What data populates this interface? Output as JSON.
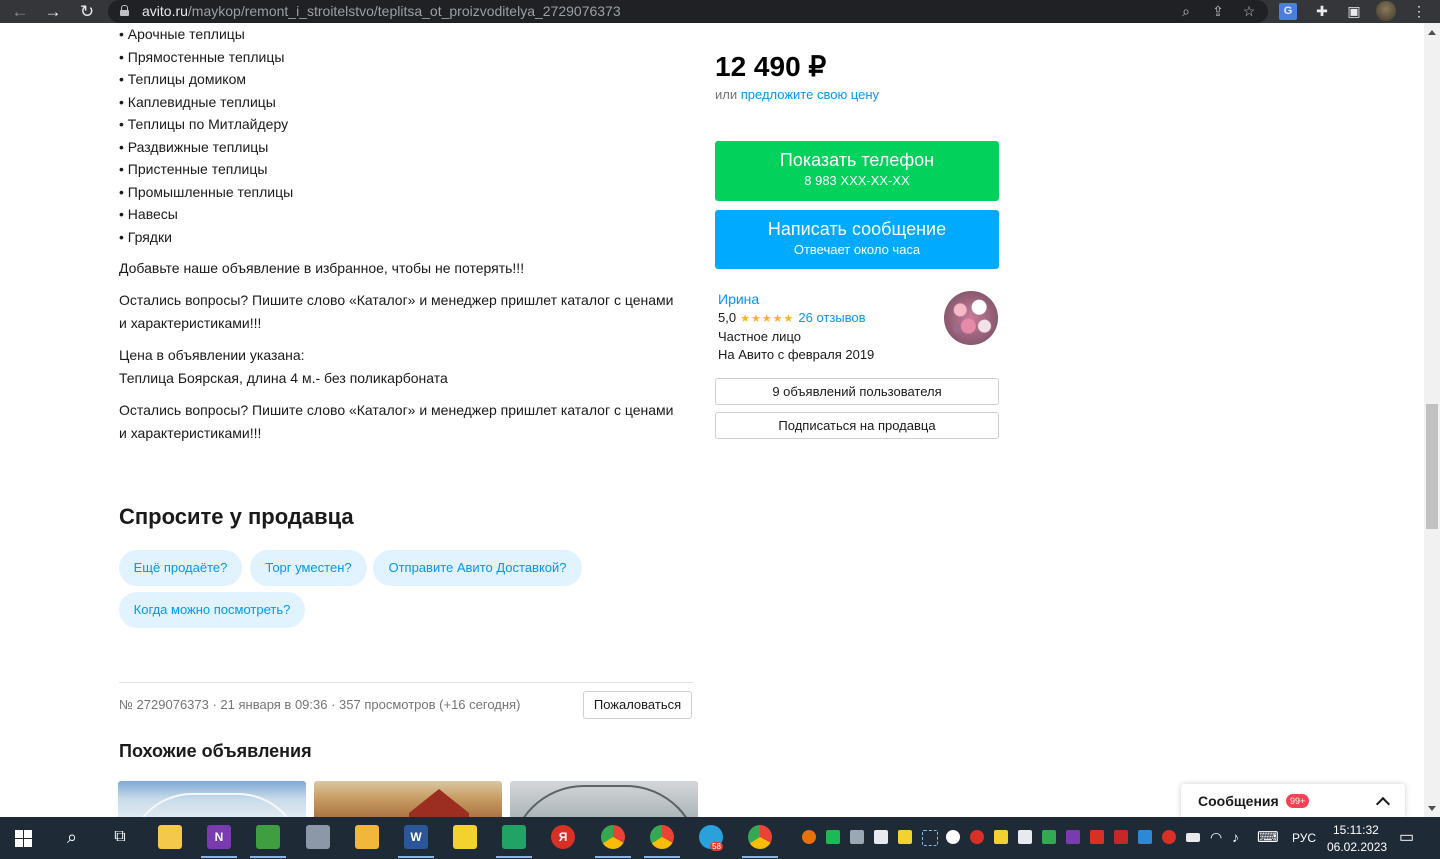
{
  "browser": {
    "url_domain": "avito.ru",
    "url_path": "/maykop/remont_i_stroitelstvo/teplitsa_ot_proizvoditelya_2729076373"
  },
  "description": {
    "bullets": [
      "• Арочные теплицы",
      "• Прямостенные теплицы",
      "• Теплицы домиком",
      "• Каплевидные теплицы",
      "• Теплицы по Митлайдеру",
      "• Раздвижные теплицы",
      "• Пристенные теплицы",
      "• Промышленные теплицы",
      "• Навесы",
      "• Грядки"
    ],
    "favorites_note": "Добавьте наше объявление в избранное, чтобы не потерять!!!",
    "questions_1": [
      "Остались вопросы? Пишите слово «Каталог» и менеджер пришлет каталог с ценами",
      "и характеристиками!!!"
    ],
    "price_note": [
      "Цена в объявлении указана:",
      "Теплица Боярская, длина 4 м.- без поликарбоната"
    ],
    "questions_2": [
      "Остались вопросы? Пишите слово «Каталог» и менеджер пришлет каталог с ценами",
      "и характеристиками!!!"
    ]
  },
  "price": {
    "value": "12 490 ₽",
    "or": "или",
    "offer_link": "предложите свою цену"
  },
  "actions": {
    "phone_label": "Показать телефон",
    "phone_number": "8 983 XXX-XX-XX",
    "message_label": "Написать сообщение",
    "message_sub": "Отвечает около часа"
  },
  "seller": {
    "name": "Ирина",
    "rating": "5,0",
    "stars": "★★★★★",
    "reviews": "26 отзывов",
    "type": "Частное лицо",
    "since": "На Авито с февраля 2019",
    "listings_button": "9 объявлений пользователя",
    "subscribe_button": "Подписаться на продавца"
  },
  "ask": {
    "title": "Спросите у продавца",
    "chips": [
      "Ещё продаёте?",
      "Торг уместен?",
      "Отправите Авито Доставкой?",
      "Когда можно посмотреть?"
    ]
  },
  "meta": {
    "info": "№ 2729076373 · 21 января в 09:36 · 357 просмотров (+16 сегодня)",
    "complain": "Пожаловаться"
  },
  "similar": {
    "title": "Похожие объявления"
  },
  "messages_widget": {
    "label": "Сообщения",
    "badge": "99+"
  },
  "taskbar": {
    "lang": "РУС",
    "time": "15:11:32",
    "date": "06.02.2023",
    "telegram_badge": "58"
  },
  "colors": {
    "phone_button": "#02d15c",
    "message_button": "#00aaff",
    "link": "#0099f7",
    "chip_bg": "#e0f3ff"
  }
}
